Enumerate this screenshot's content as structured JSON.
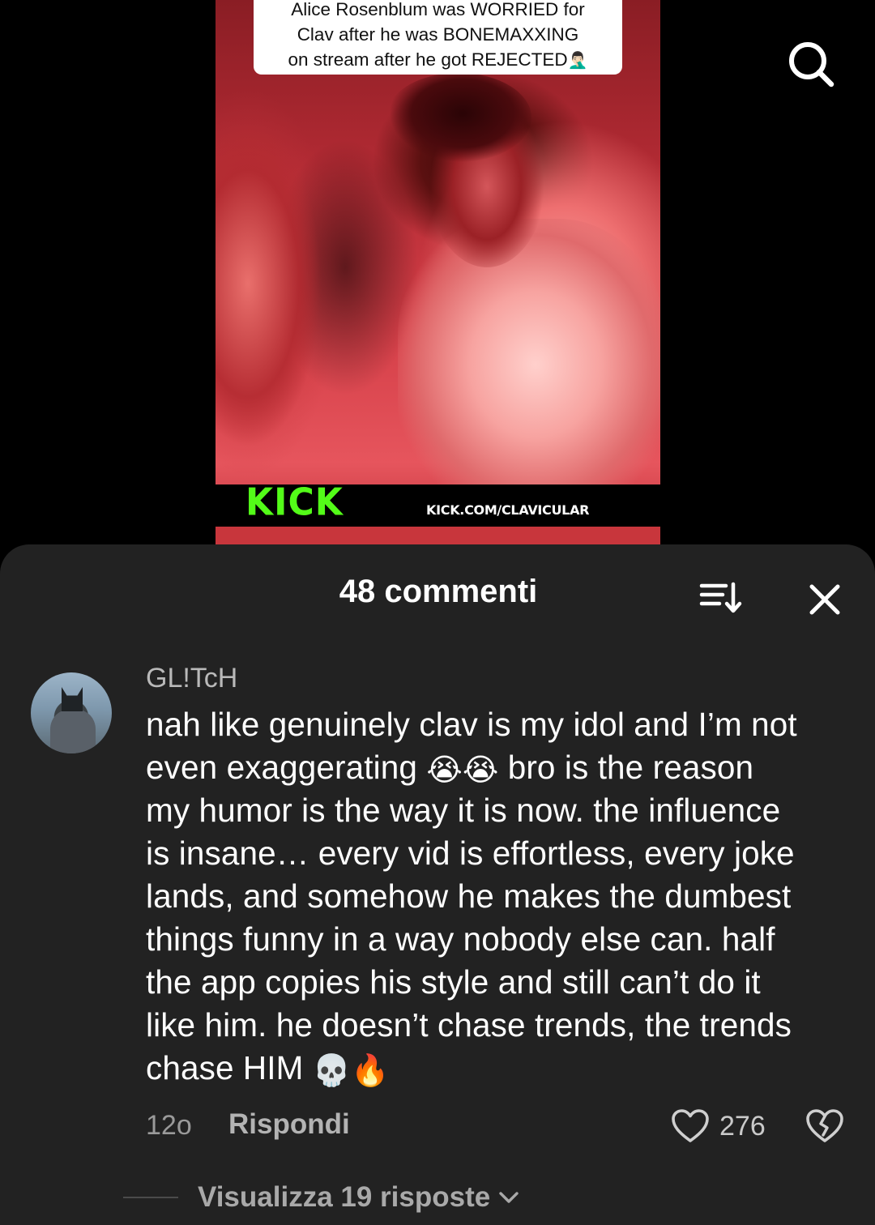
{
  "video": {
    "caption_lines": [
      "Alice Rosenblum was WORRIED for",
      "Clav after he was BONEMAXXING",
      "on stream after he got REJECTED"
    ],
    "caption_emoji": "🤦🏻‍♂️",
    "kick_logo": "KICK",
    "kick_url": "KICK.COM/CLAVICULAR",
    "logo_color": "#53fc18"
  },
  "header": {
    "search_icon": "search-icon"
  },
  "comments_sheet": {
    "title": "48 commenti",
    "sort_icon": "sort-icon",
    "close_icon": "close-icon",
    "background": "#222222"
  },
  "comment": {
    "username": "GL!TcH",
    "avatar_icon": "avatar",
    "text_lines": [
      "nah like genuinely clav is my idol and I’m not",
      "even exaggerating",
      "bro is the reason",
      "my humor is the way it is now. the influence",
      "is insane… every vid is effortless, every joke",
      "lands, and somehow he makes the dumbest",
      "things funny in a way nobody else can. half",
      "the app copies his style and still can’t do it",
      "like him. he doesn’t chase trends, the trends",
      "chase HIM"
    ],
    "emoji_crying": "😭😭",
    "emoji_end": "💀🔥",
    "time": "12o",
    "reply_label": "Rispondi",
    "like_count": "276",
    "view_replies_label": "Visualizza 19 risposte"
  }
}
